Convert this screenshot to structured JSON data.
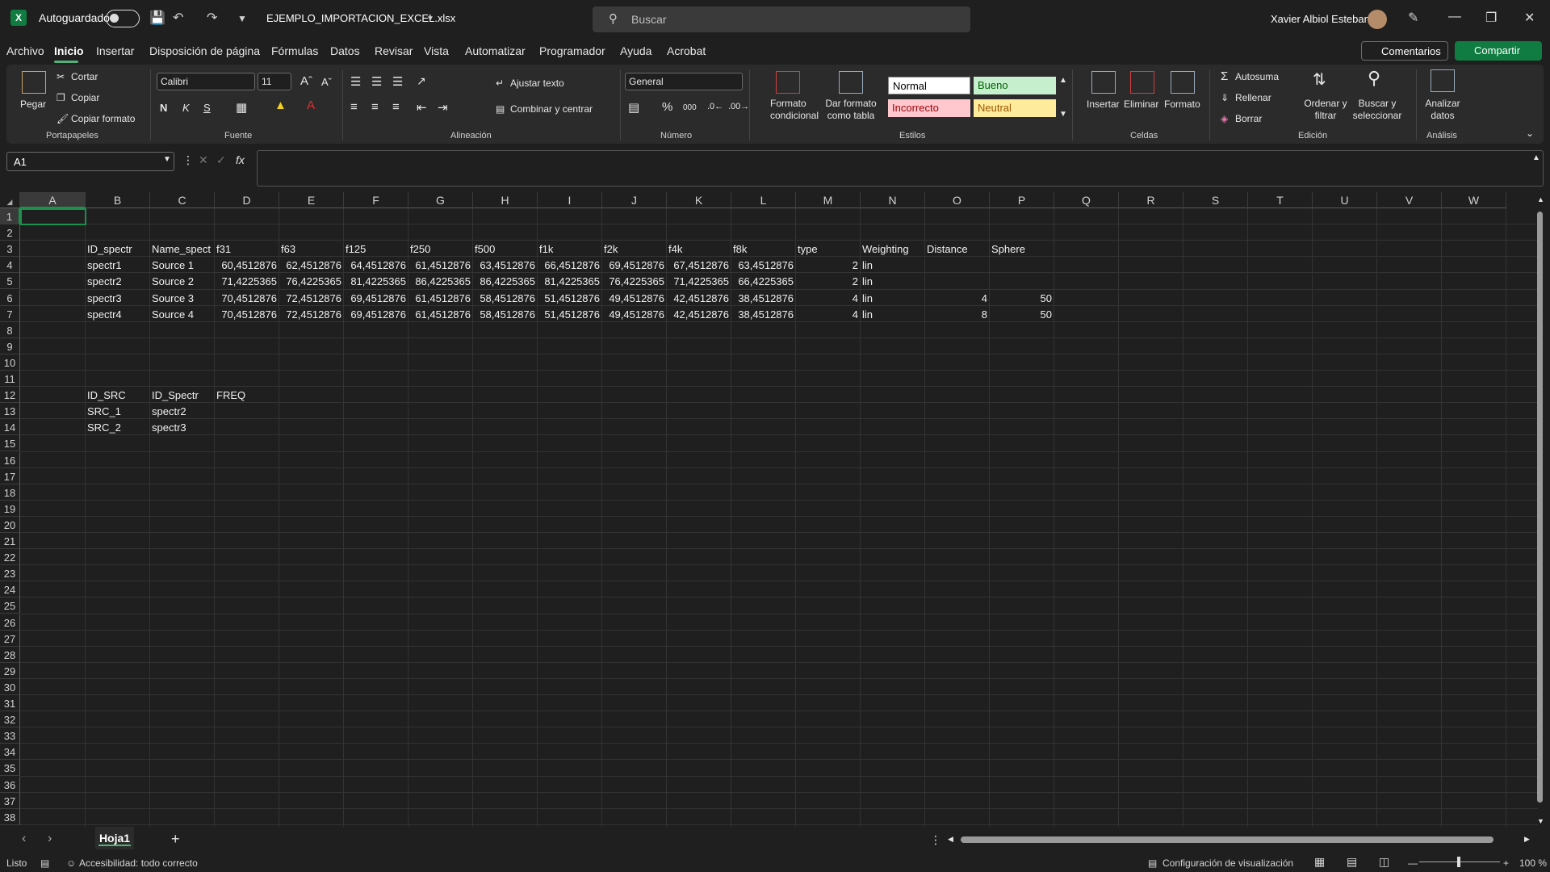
{
  "app": {
    "autosave_label": "Autoguardado",
    "filename": "EJEMPLO_IMPORTACION_EXCEL.xlsx",
    "search_placeholder": "Buscar",
    "user": "Xavier Albiol Esteban"
  },
  "menu": [
    "Archivo",
    "Inicio",
    "Insertar",
    "Disposición de página",
    "Fórmulas",
    "Datos",
    "Revisar",
    "Vista",
    "Automatizar",
    "Programador",
    "Ayuda",
    "Acrobat"
  ],
  "menu_active": "Inicio",
  "actions": {
    "comments": "Comentarios",
    "share": "Compartir"
  },
  "ribbon": {
    "clipboard": {
      "paste": "Pegar",
      "cut": "Cortar",
      "copy": "Copiar",
      "format_painter": "Copiar formato",
      "label": "Portapapeles"
    },
    "font": {
      "name": "Calibri",
      "size": "11",
      "bold": "N",
      "italic": "K",
      "underline": "S",
      "label": "Fuente"
    },
    "alignment": {
      "wrap": "Ajustar texto",
      "merge": "Combinar y centrar",
      "label": "Alineación"
    },
    "number": {
      "format": "General",
      "percent": "%",
      "thousands": "000",
      "label": "Número"
    },
    "styles": {
      "conditional": "Formato condicional",
      "as_table": "Dar formato como tabla",
      "normal": "Normal",
      "good": "Bueno",
      "bad": "Incorrecto",
      "neutral": "Neutral",
      "label": "Estilos"
    },
    "cells": {
      "insert": "Insertar",
      "delete": "Eliminar",
      "format": "Formato",
      "label": "Celdas"
    },
    "editing": {
      "autosum": "Autosuma",
      "fill": "Rellenar",
      "clear": "Borrar",
      "sort": "Ordenar y filtrar",
      "find": "Buscar y seleccionar",
      "label": "Edición"
    },
    "analysis": {
      "analyze": "Analizar datos",
      "label": "Análisis"
    }
  },
  "namebox": "A1",
  "columns": [
    "A",
    "B",
    "C",
    "D",
    "E",
    "F",
    "G",
    "H",
    "I",
    "J",
    "K",
    "L",
    "M",
    "N",
    "O",
    "P",
    "Q",
    "R",
    "S",
    "T",
    "U",
    "V",
    "W"
  ],
  "rows": 38,
  "cells": [
    {
      "r": 3,
      "c": "B",
      "v": "ID_spectr"
    },
    {
      "r": 3,
      "c": "C",
      "v": "Name_spect"
    },
    {
      "r": 3,
      "c": "D",
      "v": "f31"
    },
    {
      "r": 3,
      "c": "E",
      "v": "f63"
    },
    {
      "r": 3,
      "c": "F",
      "v": "f125"
    },
    {
      "r": 3,
      "c": "G",
      "v": "f250"
    },
    {
      "r": 3,
      "c": "H",
      "v": "f500"
    },
    {
      "r": 3,
      "c": "I",
      "v": "f1k"
    },
    {
      "r": 3,
      "c": "J",
      "v": "f2k"
    },
    {
      "r": 3,
      "c": "K",
      "v": "f4k"
    },
    {
      "r": 3,
      "c": "L",
      "v": "f8k"
    },
    {
      "r": 3,
      "c": "M",
      "v": "type"
    },
    {
      "r": 3,
      "c": "N",
      "v": "Weighting"
    },
    {
      "r": 3,
      "c": "O",
      "v": "Distance"
    },
    {
      "r": 3,
      "c": "P",
      "v": "Sphere"
    },
    {
      "r": 4,
      "c": "B",
      "v": "spectr1"
    },
    {
      "r": 4,
      "c": "C",
      "v": "Source 1"
    },
    {
      "r": 4,
      "c": "D",
      "v": "60,4512876",
      "n": true
    },
    {
      "r": 4,
      "c": "E",
      "v": "62,4512876",
      "n": true
    },
    {
      "r": 4,
      "c": "F",
      "v": "64,4512876",
      "n": true
    },
    {
      "r": 4,
      "c": "G",
      "v": "61,4512876",
      "n": true
    },
    {
      "r": 4,
      "c": "H",
      "v": "63,4512876",
      "n": true
    },
    {
      "r": 4,
      "c": "I",
      "v": "66,4512876",
      "n": true
    },
    {
      "r": 4,
      "c": "J",
      "v": "69,4512876",
      "n": true
    },
    {
      "r": 4,
      "c": "K",
      "v": "67,4512876",
      "n": true
    },
    {
      "r": 4,
      "c": "L",
      "v": "63,4512876",
      "n": true
    },
    {
      "r": 4,
      "c": "M",
      "v": "2",
      "n": true
    },
    {
      "r": 4,
      "c": "N",
      "v": "lin"
    },
    {
      "r": 5,
      "c": "B",
      "v": "spectr2"
    },
    {
      "r": 5,
      "c": "C",
      "v": "Source 2"
    },
    {
      "r": 5,
      "c": "D",
      "v": "71,4225365",
      "n": true
    },
    {
      "r": 5,
      "c": "E",
      "v": "76,4225365",
      "n": true
    },
    {
      "r": 5,
      "c": "F",
      "v": "81,4225365",
      "n": true
    },
    {
      "r": 5,
      "c": "G",
      "v": "86,4225365",
      "n": true
    },
    {
      "r": 5,
      "c": "H",
      "v": "86,4225365",
      "n": true
    },
    {
      "r": 5,
      "c": "I",
      "v": "81,4225365",
      "n": true
    },
    {
      "r": 5,
      "c": "J",
      "v": "76,4225365",
      "n": true
    },
    {
      "r": 5,
      "c": "K",
      "v": "71,4225365",
      "n": true
    },
    {
      "r": 5,
      "c": "L",
      "v": "66,4225365",
      "n": true
    },
    {
      "r": 5,
      "c": "M",
      "v": "2",
      "n": true
    },
    {
      "r": 5,
      "c": "N",
      "v": "lin"
    },
    {
      "r": 6,
      "c": "B",
      "v": "spectr3"
    },
    {
      "r": 6,
      "c": "C",
      "v": "Source 3"
    },
    {
      "r": 6,
      "c": "D",
      "v": "70,4512876",
      "n": true
    },
    {
      "r": 6,
      "c": "E",
      "v": "72,4512876",
      "n": true
    },
    {
      "r": 6,
      "c": "F",
      "v": "69,4512876",
      "n": true
    },
    {
      "r": 6,
      "c": "G",
      "v": "61,4512876",
      "n": true
    },
    {
      "r": 6,
      "c": "H",
      "v": "58,4512876",
      "n": true
    },
    {
      "r": 6,
      "c": "I",
      "v": "51,4512876",
      "n": true
    },
    {
      "r": 6,
      "c": "J",
      "v": "49,4512876",
      "n": true
    },
    {
      "r": 6,
      "c": "K",
      "v": "42,4512876",
      "n": true
    },
    {
      "r": 6,
      "c": "L",
      "v": "38,4512876",
      "n": true
    },
    {
      "r": 6,
      "c": "M",
      "v": "4",
      "n": true
    },
    {
      "r": 6,
      "c": "N",
      "v": "lin"
    },
    {
      "r": 6,
      "c": "O",
      "v": "4",
      "n": true
    },
    {
      "r": 6,
      "c": "P",
      "v": "50",
      "n": true
    },
    {
      "r": 7,
      "c": "B",
      "v": "spectr4"
    },
    {
      "r": 7,
      "c": "C",
      "v": "Source 4"
    },
    {
      "r": 7,
      "c": "D",
      "v": "70,4512876",
      "n": true
    },
    {
      "r": 7,
      "c": "E",
      "v": "72,4512876",
      "n": true
    },
    {
      "r": 7,
      "c": "F",
      "v": "69,4512876",
      "n": true
    },
    {
      "r": 7,
      "c": "G",
      "v": "61,4512876",
      "n": true
    },
    {
      "r": 7,
      "c": "H",
      "v": "58,4512876",
      "n": true
    },
    {
      "r": 7,
      "c": "I",
      "v": "51,4512876",
      "n": true
    },
    {
      "r": 7,
      "c": "J",
      "v": "49,4512876",
      "n": true
    },
    {
      "r": 7,
      "c": "K",
      "v": "42,4512876",
      "n": true
    },
    {
      "r": 7,
      "c": "L",
      "v": "38,4512876",
      "n": true
    },
    {
      "r": 7,
      "c": "M",
      "v": "4",
      "n": true
    },
    {
      "r": 7,
      "c": "N",
      "v": "lin"
    },
    {
      "r": 7,
      "c": "O",
      "v": "8",
      "n": true
    },
    {
      "r": 7,
      "c": "P",
      "v": "50",
      "n": true
    },
    {
      "r": 12,
      "c": "B",
      "v": "ID_SRC"
    },
    {
      "r": 12,
      "c": "C",
      "v": "ID_Spectr"
    },
    {
      "r": 12,
      "c": "D",
      "v": "FREQ"
    },
    {
      "r": 13,
      "c": "B",
      "v": "SRC_1"
    },
    {
      "r": 13,
      "c": "C",
      "v": "spectr2"
    },
    {
      "r": 14,
      "c": "B",
      "v": "SRC_2"
    },
    {
      "r": 14,
      "c": "C",
      "v": "spectr3"
    }
  ],
  "sheets": [
    "Hoja1"
  ],
  "status": {
    "ready": "Listo",
    "accessibility": "Accesibilidad: todo correcto",
    "display_settings": "Configuración de visualización",
    "zoom": "100 %"
  }
}
